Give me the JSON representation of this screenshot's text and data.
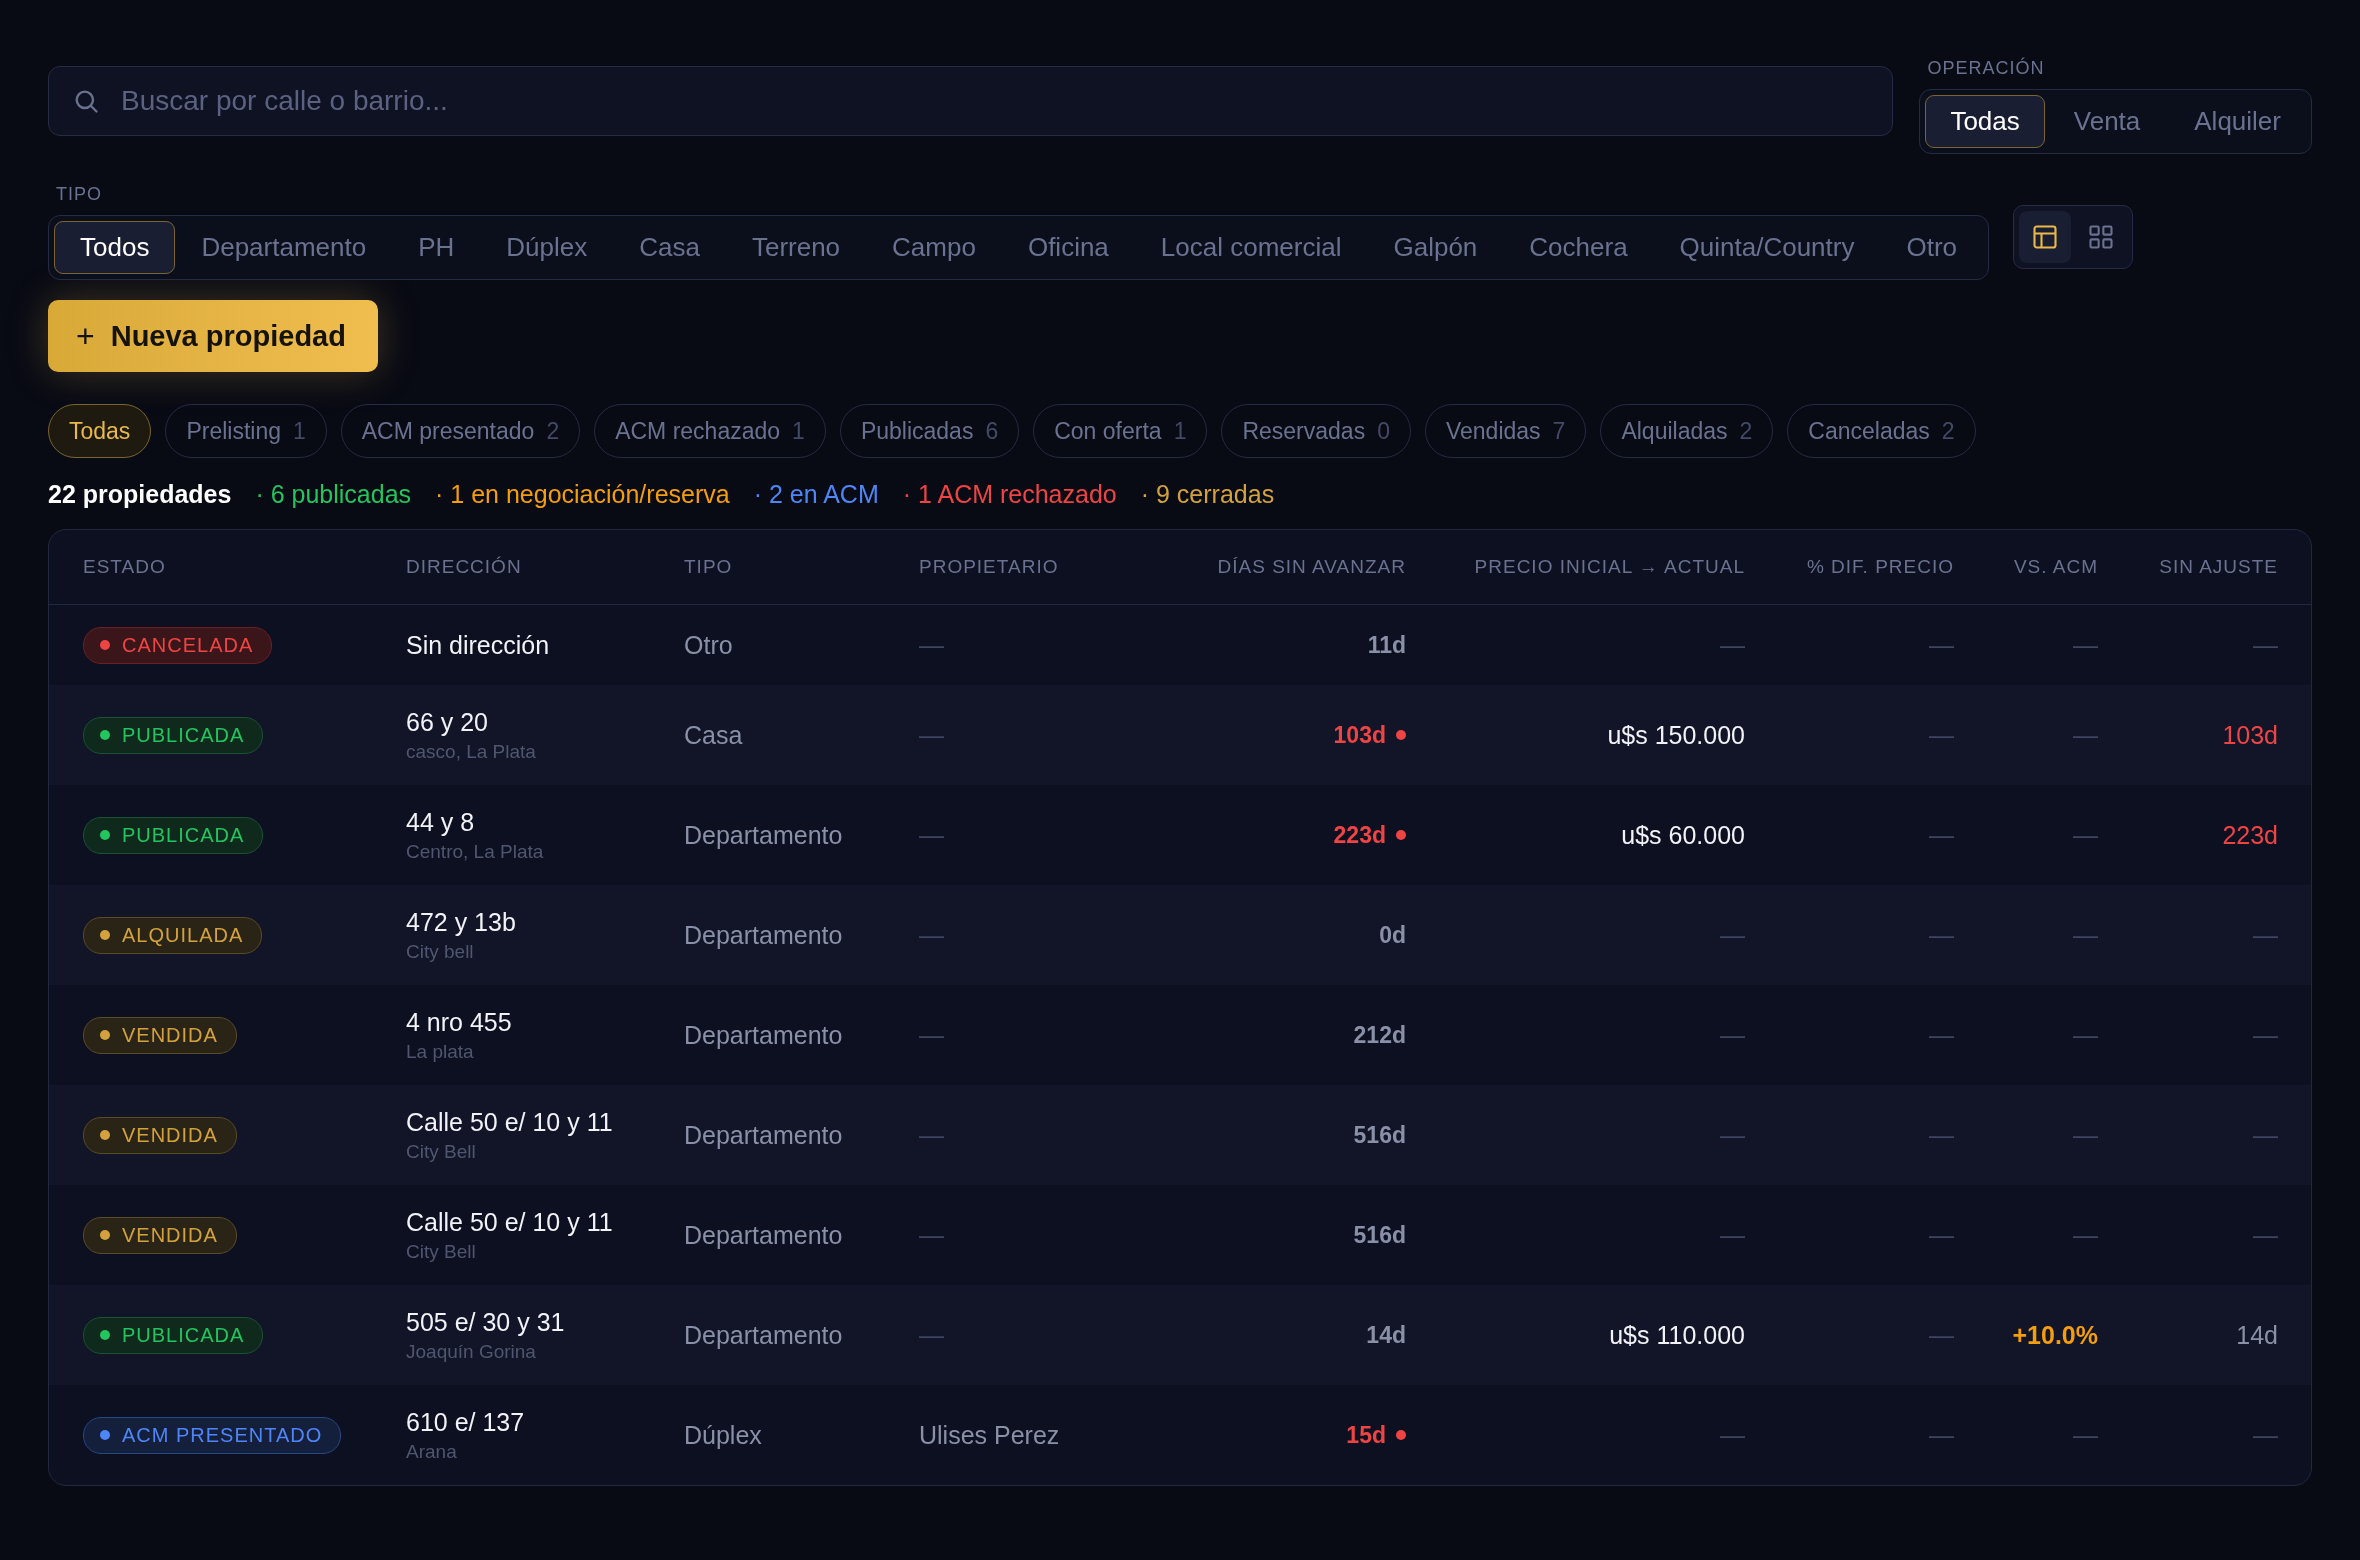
{
  "search": {
    "placeholder": "Buscar por calle o barrio..."
  },
  "operation": {
    "label": "OPERACIÓN",
    "options": [
      {
        "label": "Todas",
        "selected": true
      },
      {
        "label": "Venta",
        "selected": false
      },
      {
        "label": "Alquiler",
        "selected": false
      }
    ]
  },
  "type_filter": {
    "label": "TIPO",
    "options": [
      {
        "label": "Todos",
        "selected": true
      },
      {
        "label": "Departamento",
        "selected": false
      },
      {
        "label": "PH",
        "selected": false
      },
      {
        "label": "Dúplex",
        "selected": false
      },
      {
        "label": "Casa",
        "selected": false
      },
      {
        "label": "Terreno",
        "selected": false
      },
      {
        "label": "Campo",
        "selected": false
      },
      {
        "label": "Oficina",
        "selected": false
      },
      {
        "label": "Local comercial",
        "selected": false
      },
      {
        "label": "Galpón",
        "selected": false
      },
      {
        "label": "Cochera",
        "selected": false
      },
      {
        "label": "Quinta/Country",
        "selected": false
      },
      {
        "label": "Otro",
        "selected": false
      }
    ]
  },
  "view_toggle": [
    {
      "kind": "table",
      "selected": true
    },
    {
      "kind": "grid",
      "selected": false
    }
  ],
  "new_button": {
    "icon": "+",
    "label": "Nueva propiedad"
  },
  "status_chips": [
    {
      "label": "Todas",
      "selected": true
    },
    {
      "label": "Prelisting",
      "count": "1",
      "selected": false
    },
    {
      "label": "ACM presentado",
      "count": "2",
      "selected": false
    },
    {
      "label": "ACM rechazado",
      "count": "1",
      "selected": false
    },
    {
      "label": "Publicadas",
      "count": "6",
      "selected": false
    },
    {
      "label": "Con oferta",
      "count": "1",
      "selected": false
    },
    {
      "label": "Reservadas",
      "count": "0",
      "selected": false
    },
    {
      "label": "Vendidas",
      "count": "7",
      "selected": false
    },
    {
      "label": "Alquiladas",
      "count": "2",
      "selected": false
    },
    {
      "label": "Canceladas",
      "count": "2",
      "selected": false
    }
  ],
  "summary": {
    "total": "22 propiedades",
    "segments": [
      {
        "text": "· 6 publicadas",
        "color": "#22c55e"
      },
      {
        "text": "· 1 en negociación/reserva",
        "color": "#f59e0b"
      },
      {
        "text": "· 2 en ACM",
        "color": "#4f86f7"
      },
      {
        "text": "· 1 ACM rechazado",
        "color": "#ef4444"
      },
      {
        "text": "· 9 cerradas",
        "color": "#d4a23c"
      }
    ]
  },
  "table": {
    "columns": [
      "ESTADO",
      "DIRECCIÓN",
      "TIPO",
      "PROPIETARIO",
      "DÍAS SIN AVANZAR",
      "PRECIO INICIAL → ACTUAL",
      "% DIF. PRECIO",
      "VS. ACM",
      "SIN AJUSTE"
    ],
    "rows": [
      {
        "status": {
          "label": "CANCELADA",
          "kind": "cancelada"
        },
        "address": "Sin dirección",
        "type": "Otro",
        "owner": {
          "text": "—",
          "muted": true
        },
        "days": {
          "text": "11d",
          "alert": false
        },
        "price": {
          "text": "—",
          "muted": true
        },
        "price_dif": "—",
        "vs_acm": {
          "text": "—",
          "highlight": false
        },
        "sin_ajuste": {
          "text": "—",
          "alert": false,
          "muted": true
        }
      },
      {
        "status": {
          "label": "PUBLICADA",
          "kind": "publicada"
        },
        "address": "66 y 20",
        "area": "casco, La Plata",
        "type": "Casa",
        "owner": {
          "text": "—",
          "muted": true
        },
        "days": {
          "text": "103d",
          "alert": true
        },
        "price": {
          "text": "u$s 150.000",
          "muted": false
        },
        "price_dif": "—",
        "vs_acm": {
          "text": "—",
          "highlight": false
        },
        "sin_ajuste": {
          "text": "103d",
          "alert": true
        }
      },
      {
        "status": {
          "label": "PUBLICADA",
          "kind": "publicada"
        },
        "address": "44 y 8",
        "area": "Centro, La Plata",
        "type": "Departamento",
        "owner": {
          "text": "—",
          "muted": true
        },
        "days": {
          "text": "223d",
          "alert": true
        },
        "price": {
          "text": "u$s 60.000",
          "muted": false
        },
        "price_dif": "—",
        "vs_acm": {
          "text": "—",
          "highlight": false
        },
        "sin_ajuste": {
          "text": "223d",
          "alert": true
        }
      },
      {
        "status": {
          "label": "ALQUILADA",
          "kind": "cerrada"
        },
        "address": "472 y 13b",
        "area": "City bell",
        "type": "Departamento",
        "owner": {
          "text": "—",
          "muted": true
        },
        "days": {
          "text": "0d",
          "alert": false
        },
        "price": {
          "text": "—",
          "muted": true
        },
        "price_dif": "—",
        "vs_acm": {
          "text": "—",
          "highlight": false
        },
        "sin_ajuste": {
          "text": "—",
          "alert": false,
          "muted": true
        }
      },
      {
        "status": {
          "label": "VENDIDA",
          "kind": "cerrada"
        },
        "address": "4 nro 455",
        "area": "La plata",
        "type": "Departamento",
        "owner": {
          "text": "—",
          "muted": true
        },
        "days": {
          "text": "212d",
          "alert": false
        },
        "price": {
          "text": "—",
          "muted": true
        },
        "price_dif": "—",
        "vs_acm": {
          "text": "—",
          "highlight": false
        },
        "sin_ajuste": {
          "text": "—",
          "alert": false,
          "muted": true
        }
      },
      {
        "status": {
          "label": "VENDIDA",
          "kind": "cerrada"
        },
        "address": "Calle 50 e/ 10 y 11",
        "area": "City Bell",
        "type": "Departamento",
        "owner": {
          "text": "—",
          "muted": true
        },
        "days": {
          "text": "516d",
          "alert": false
        },
        "price": {
          "text": "—",
          "muted": true
        },
        "price_dif": "—",
        "vs_acm": {
          "text": "—",
          "highlight": false
        },
        "sin_ajuste": {
          "text": "—",
          "alert": false,
          "muted": true
        }
      },
      {
        "status": {
          "label": "VENDIDA",
          "kind": "cerrada"
        },
        "address": "Calle 50 e/ 10 y 11",
        "area": "City Bell",
        "type": "Departamento",
        "owner": {
          "text": "—",
          "muted": true
        },
        "days": {
          "text": "516d",
          "alert": false
        },
        "price": {
          "text": "—",
          "muted": true
        },
        "price_dif": "—",
        "vs_acm": {
          "text": "—",
          "highlight": false
        },
        "sin_ajuste": {
          "text": "—",
          "alert": false,
          "muted": true
        }
      },
      {
        "status": {
          "label": "PUBLICADA",
          "kind": "publicada"
        },
        "address": "505 e/ 30 y 31",
        "area": "Joaquín Gorina",
        "type": "Departamento",
        "owner": {
          "text": "—",
          "muted": true
        },
        "days": {
          "text": "14d",
          "alert": false
        },
        "price": {
          "text": "u$s 110.000",
          "muted": false
        },
        "price_dif": "—",
        "vs_acm": {
          "text": "+10.0%",
          "highlight": true
        },
        "sin_ajuste": {
          "text": "14d",
          "alert": false,
          "muted": false
        }
      },
      {
        "status": {
          "label": "ACM PRESENTADO",
          "kind": "acm"
        },
        "address": "610 e/ 137",
        "area": "Arana",
        "type": "Dúplex",
        "owner": {
          "text": "Ulises Perez",
          "muted": false
        },
        "days": {
          "text": "15d",
          "alert": true
        },
        "price": {
          "text": "—",
          "muted": true
        },
        "price_dif": "—",
        "vs_acm": {
          "text": "—",
          "highlight": false
        },
        "sin_ajuste": {
          "text": "—",
          "alert": false,
          "muted": true
        }
      }
    ]
  }
}
